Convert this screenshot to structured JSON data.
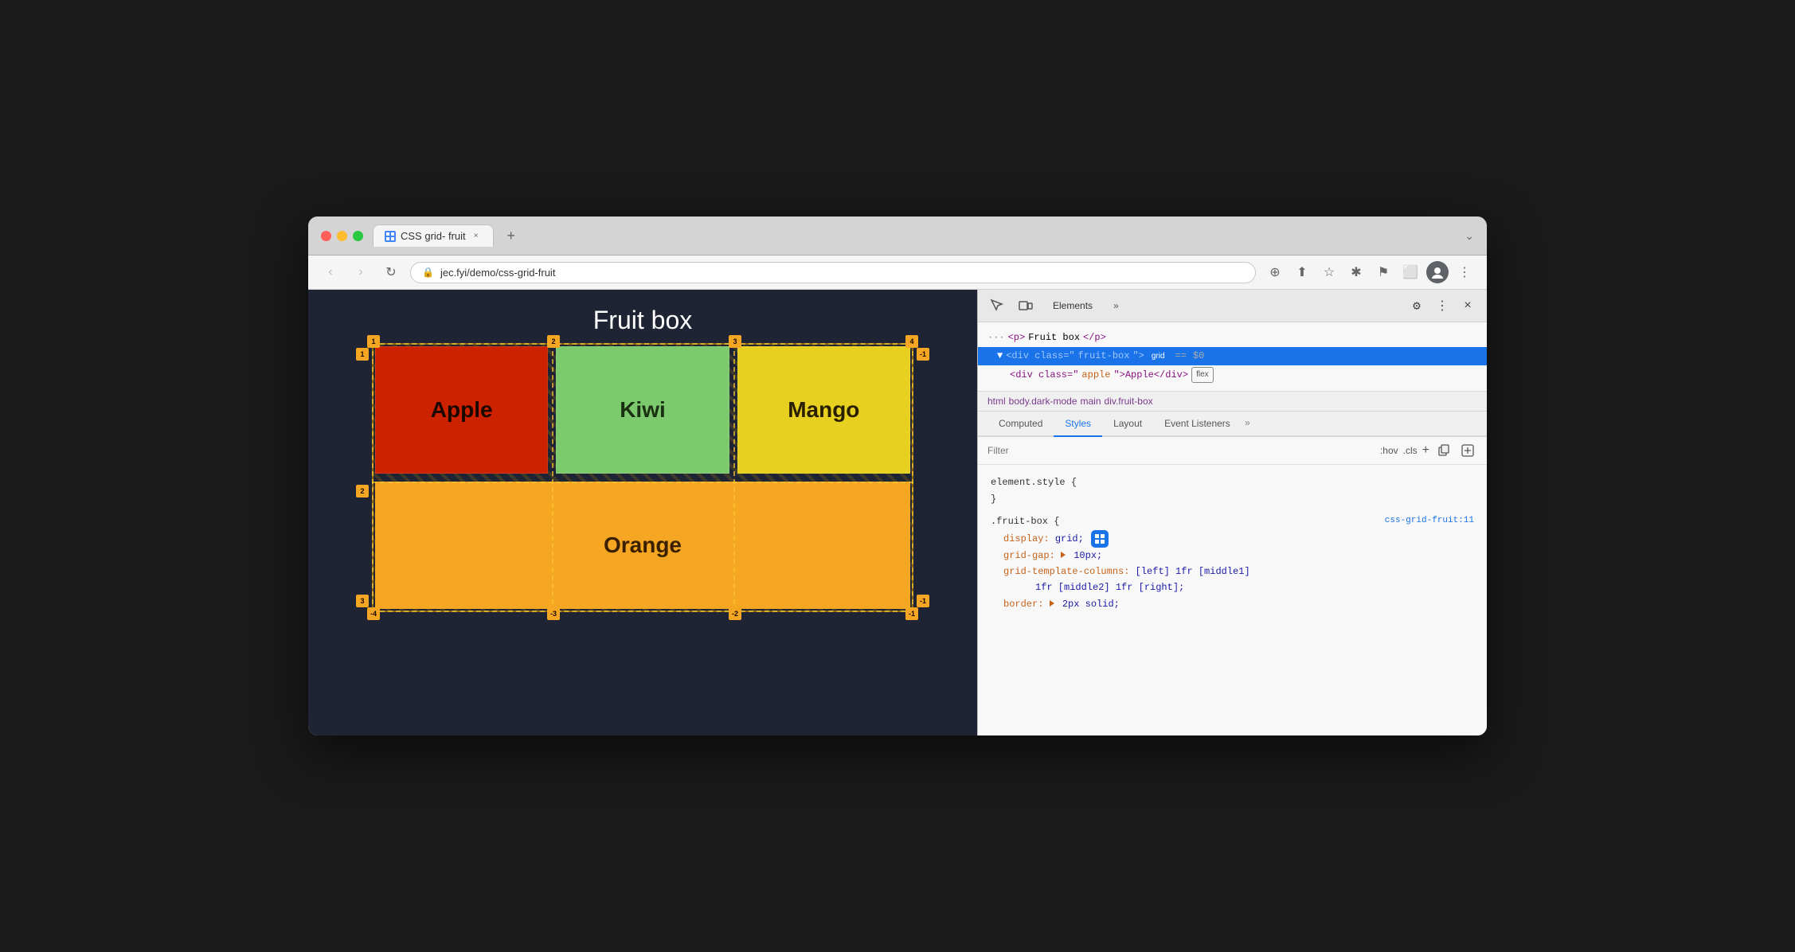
{
  "browser": {
    "tab_title": "CSS grid- fruit",
    "tab_favicon": "🌐",
    "tab_close": "×",
    "tab_new": "+",
    "url": "jec.fyi/demo/css-grid-fruit",
    "chevron": "⌄",
    "nav_back": "‹",
    "nav_forward": "›",
    "nav_refresh": "↻",
    "addr_icons": [
      "⊕",
      "⬆",
      "☆",
      "✱",
      "⚑",
      "⬜",
      "👤",
      "⋮"
    ]
  },
  "webpage": {
    "title": "Fruit box",
    "apple": "Apple",
    "kiwi": "Kiwi",
    "mango": "Mango",
    "orange": "Orange"
  },
  "devtools": {
    "tab_elements": "Elements",
    "tab_more": "»",
    "gear_icon": "⚙",
    "more_icon": "⋮",
    "close_icon": "×",
    "dom": {
      "line1": "<p>Fruit box</p>",
      "line2_pre": "<div class=\"fruit-box\">",
      "line2_badge": "grid",
      "line2_eq": "==",
      "line2_dollar": "$0",
      "line3_pre": "<div class=\"apple\">Apple</div>",
      "line3_badge": "flex"
    },
    "breadcrumb": [
      "html",
      "body.dark-mode",
      "main",
      "div.fruit-box"
    ],
    "styles_tabs": [
      "Computed",
      "Styles",
      "Layout",
      "Event Listeners",
      "»"
    ],
    "filter_placeholder": "Filter",
    "filter_hov": ":hov",
    "filter_cls": ".cls",
    "filter_plus": "+",
    "css_blocks": [
      {
        "selector": "element.style {",
        "body": "}",
        "source": ""
      },
      {
        "selector": ".fruit-box {",
        "source": "css-grid-fruit:11",
        "props": [
          {
            "prop": "display:",
            "val": "grid;",
            "icon": true
          },
          {
            "prop": "grid-gap:",
            "val": "▶ 10px;"
          },
          {
            "prop": "grid-template-columns:",
            "val": "[left] 1fr [middle1]"
          },
          {
            "prop": "",
            "val": "1fr [middle2] 1fr [right];"
          },
          {
            "prop": "border:",
            "val": "▶ 2px solid;"
          }
        ],
        "body": ""
      }
    ]
  }
}
